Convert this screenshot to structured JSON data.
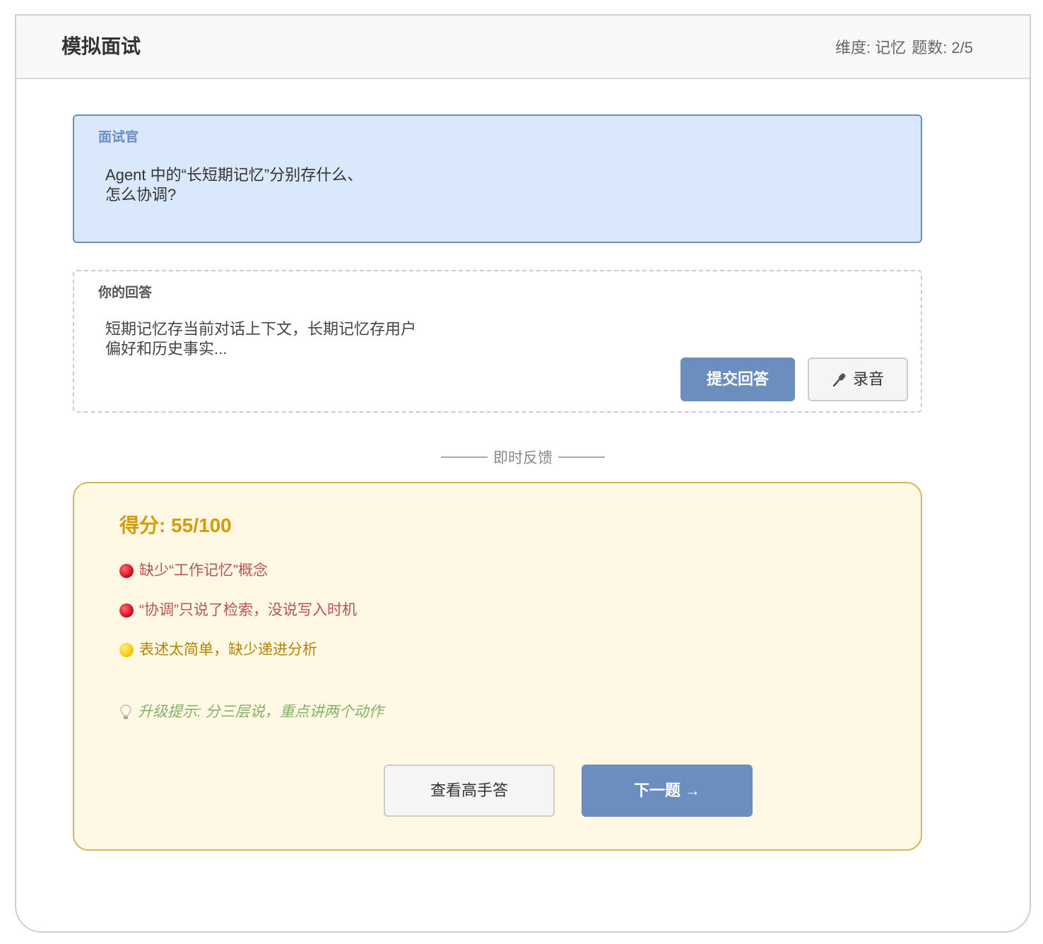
{
  "header": {
    "title": "模拟面试",
    "dimension": "维度: 记忆",
    "progress": "题数: 2/5"
  },
  "question": {
    "label": "面试官",
    "text": "Agent 中的“长短期记忆”分别存什么、\n怎么协调?"
  },
  "answer": {
    "label": "你的回答",
    "text": "短期记忆存当前对话上下文，长期记忆存用户\n偏好和历史事实...",
    "submit_label": "提交回答",
    "record_label": "录音",
    "record_icon": "microphone-icon"
  },
  "divider": {
    "label": "即时反馈"
  },
  "feedback": {
    "score": "得分: 55/100",
    "issues": [
      {
        "text": "缺少“工作记忆”概念",
        "level": "red"
      },
      {
        "text": "“协调”只说了检索，没说写入时机",
        "level": "red"
      },
      {
        "text": "表述太简单，缺少递进分析",
        "level": "yellow"
      }
    ],
    "tip": "升级提示: 分三层说，重点讲两个动作",
    "tip_icon": "lightbulb-icon",
    "view_label": "查看高手答",
    "next_label": "下一题 →"
  },
  "colors": {
    "accent": "#6c8ebf",
    "question_bg": "#dae8fc",
    "feedback_bg": "#fff8e5",
    "feedback_border": "#d6b656",
    "score": "#d79b00",
    "error": "#b85450",
    "tip": "#82b366"
  }
}
